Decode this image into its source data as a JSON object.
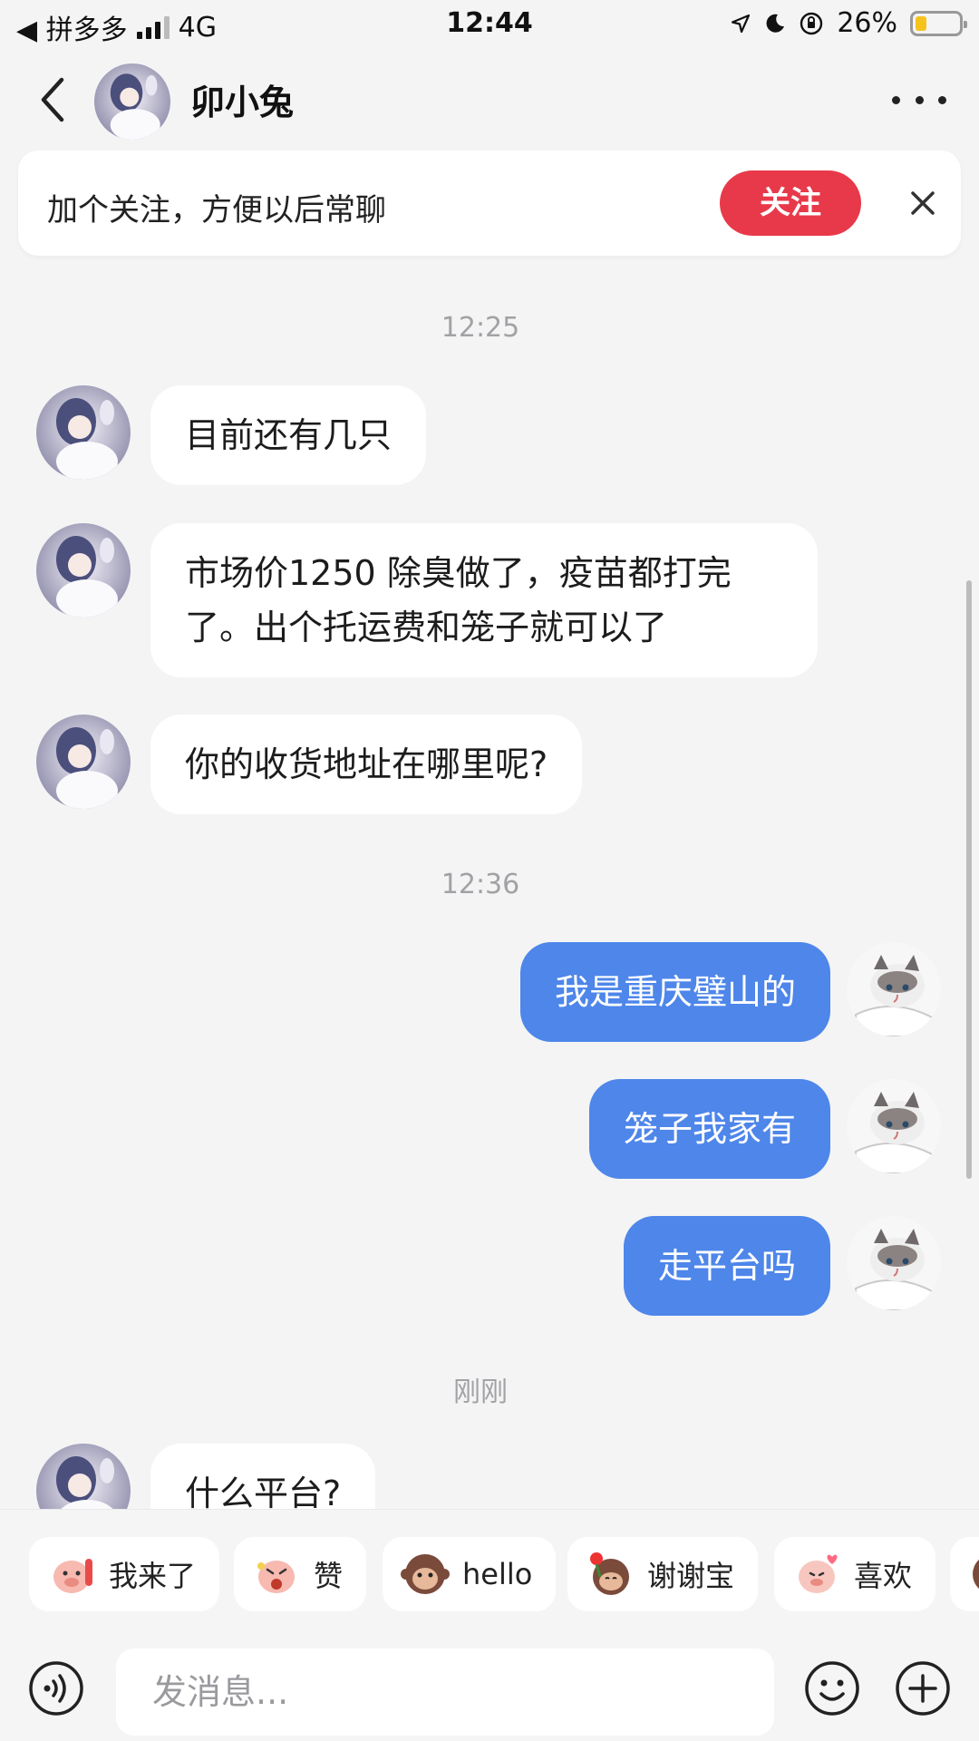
{
  "status_bar": {
    "back_app": "◀ 拼多多",
    "network": "4G",
    "time": "12:44",
    "battery_text": "26%",
    "battery_level": 0.26
  },
  "header": {
    "contact_name": "卯小兔"
  },
  "follow_banner": {
    "text": "加个关注，方便以后常聊",
    "follow_label": "关注"
  },
  "chat": {
    "timestamps": [
      "12:25",
      "12:36",
      "刚刚"
    ],
    "messages": [
      {
        "from": "other",
        "text": "目前还有几只"
      },
      {
        "from": "other",
        "text": "市场价1250 除臭做了，疫苗都打完了。出个托运费和笼子就可以了"
      },
      {
        "from": "other",
        "text": "你的收货地址在哪里呢?"
      },
      {
        "from": "me",
        "text": "我是重庆璧山的"
      },
      {
        "from": "me",
        "text": "笼子我家有"
      },
      {
        "from": "me",
        "text": "走平台吗"
      },
      {
        "from": "other",
        "text": "什么平台?"
      }
    ]
  },
  "quick_replies": [
    {
      "label": "我来了",
      "icon": "pig-wave-sticker-icon"
    },
    {
      "label": "赞",
      "icon": "pig-thumbs-sticker-icon"
    },
    {
      "label": "hello",
      "icon": "monkey-sticker-icon"
    },
    {
      "label": "谢谢宝",
      "icon": "monkey-rose-sticker-icon"
    },
    {
      "label": "喜欢",
      "icon": "pig-heart-sticker-icon"
    }
  ],
  "input": {
    "placeholder": "发消息..."
  }
}
